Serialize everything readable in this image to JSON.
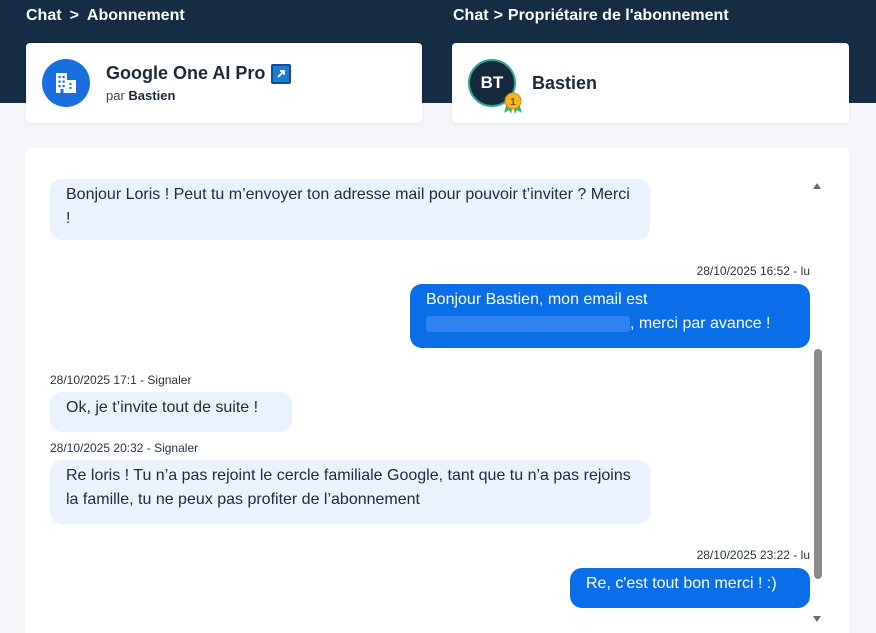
{
  "breadcrumbs": {
    "left": {
      "root": "Chat",
      "separator": ">",
      "current": "Abonnement"
    },
    "right": {
      "root": "Chat",
      "separator": ">",
      "current": "Propriétaire de l'abonnement"
    }
  },
  "subscription": {
    "icon": "building-icon",
    "title": "Google One AI Pro",
    "external_link_icon": "external-link-icon",
    "by_prefix": "par",
    "owner": "Bastien"
  },
  "owner_card": {
    "initials": "BT",
    "badge_icon": "medal-icon",
    "badge_number": "1",
    "name": "Bastien"
  },
  "messages": [
    {
      "direction": "incoming",
      "meta": "",
      "text": "Bonjour Loris ! Peut tu m’envoyer ton adresse mail pour pouvoir t’inviter ? Merci !"
    },
    {
      "direction": "outgoing",
      "meta": "28/10/2025 16:52 - lu",
      "text_before": "Bonjour Bastien, mon email est",
      "text_after": ", merci par avance !"
    },
    {
      "direction": "incoming",
      "meta": "28/10/2025 17:1 - Signaler",
      "text": "Ok, je t’invite tout de suite !"
    },
    {
      "direction": "incoming",
      "meta": "28/10/2025 20:32 - Signaler",
      "text": "Re loris ! Tu n’a pas rejoint le cercle familiale Google, tant que tu n’a pas rejoins la famille, tu ne peux pas profiter de l’abonnement"
    },
    {
      "direction": "outgoing",
      "meta": "28/10/2025 23:22 - lu",
      "text": "Re, c'est tout bon merci ! :)"
    }
  ],
  "colors": {
    "header_bg": "#142d45",
    "outgoing_bubble": "#0a6ee8",
    "incoming_bubble": "#eaf2fd",
    "accent": "#1a6fe0"
  }
}
